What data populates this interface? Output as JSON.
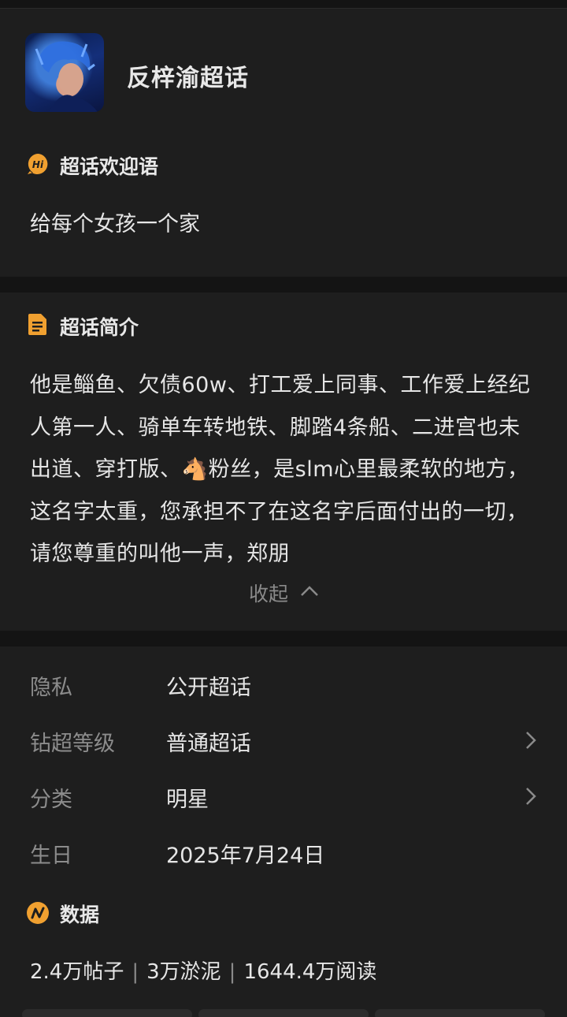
{
  "header": {
    "topic_name": "反梓渝超话"
  },
  "welcome": {
    "title": "超话欢迎语",
    "icon": "hi-icon",
    "text": "给每个女孩一个家"
  },
  "intro": {
    "title": "超话简介",
    "icon": "document-icon",
    "part1": "他是鲻鱼、欠债60w、打工爱上同事、工作爱上经纪人第一人、骑单车转地铁、脚踏4条船、二进宫也未出道、穿打版、",
    "emoji": "🐴",
    "part2": "粉丝，是slm心里最柔软的地方，这名字太重，您承担不了在这名字后面付出的一切，请您尊重的叫他一声，郑朋",
    "collapse_label": "收起"
  },
  "info": {
    "rows": [
      {
        "label": "隐私",
        "value": "公开超话"
      },
      {
        "label": "钻超等级",
        "value": "普通超话"
      },
      {
        "label": "分类",
        "value": "明星"
      },
      {
        "label": "生日",
        "value": "2025年7月24日"
      }
    ]
  },
  "data_section": {
    "title": "数据",
    "icon": "stats-icon",
    "posts": "2.4万帖子",
    "mud": "3万淤泥",
    "reads": "1644.4万阅读",
    "separator": "|"
  },
  "colors": {
    "background": "#1b1b1b",
    "card": "#1e1e1e",
    "accent_orange": "#f0a030",
    "text_primary": "#e6e6e6",
    "text_muted": "#8c8c8c"
  }
}
